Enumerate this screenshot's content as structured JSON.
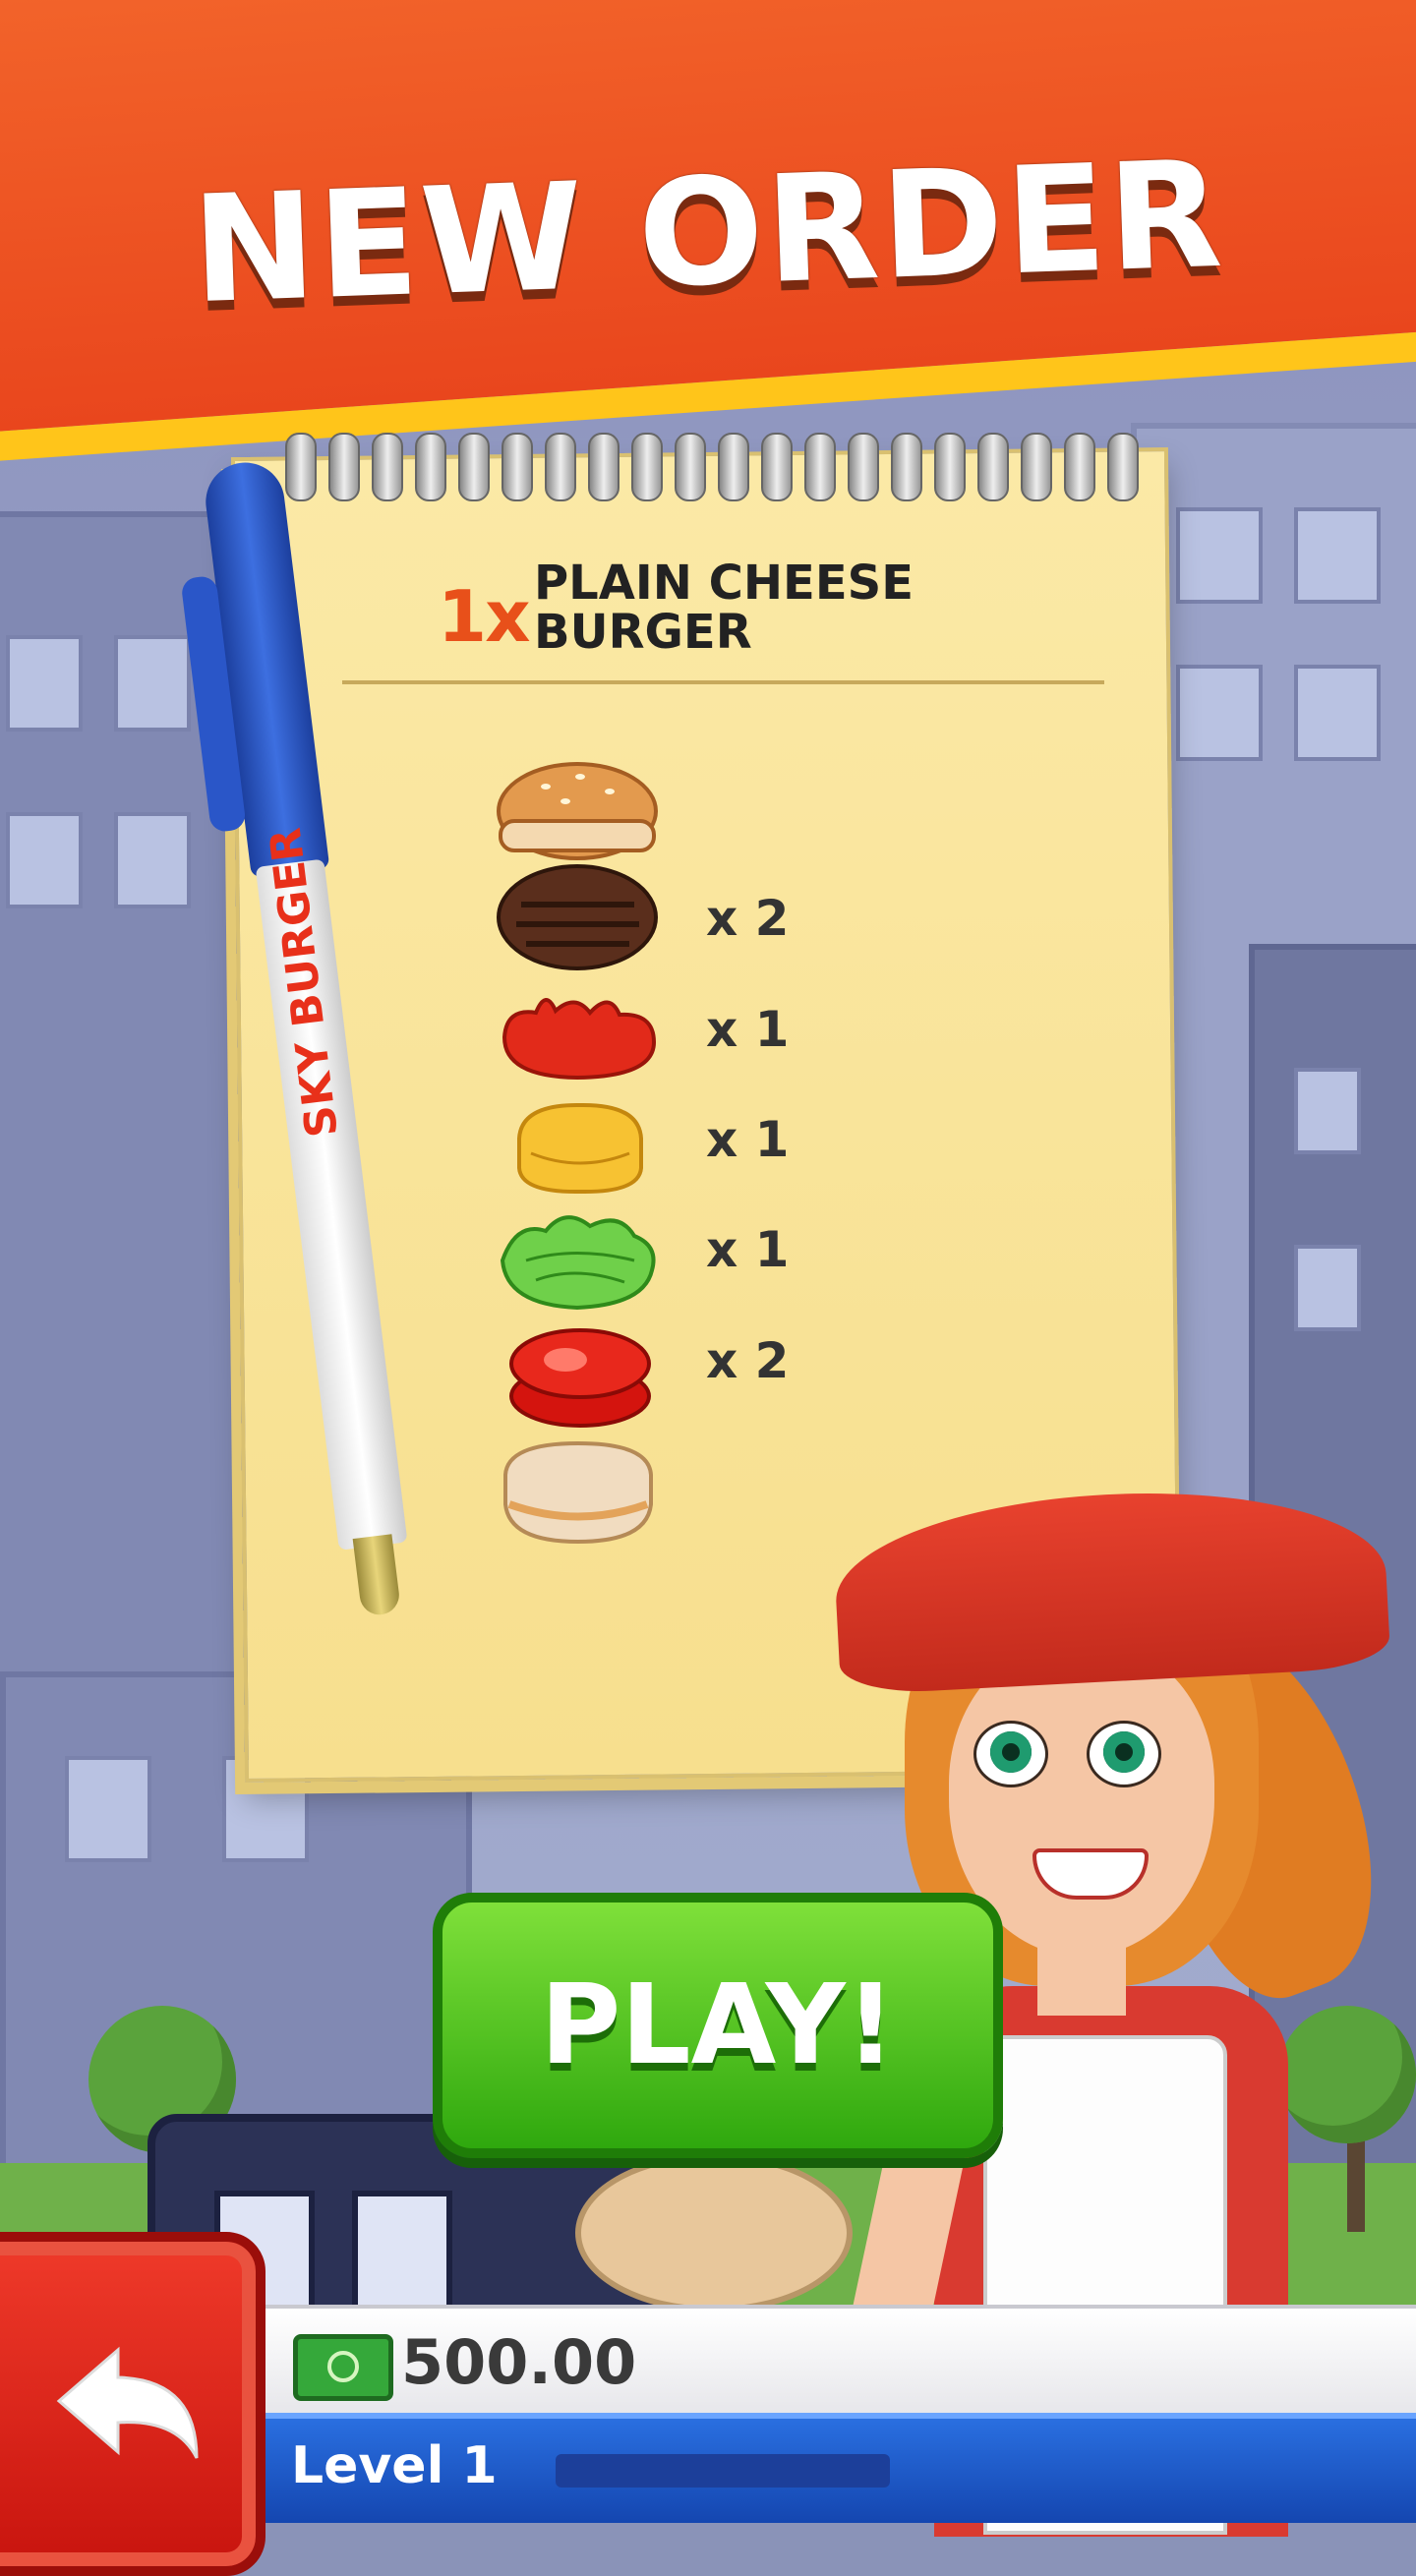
{
  "header": {
    "title": "NEW ORDER"
  },
  "order": {
    "quantity": "1x",
    "item_name": "PLAIN CHEESE BURGER"
  },
  "pen": {
    "brand": "SKY BURGER"
  },
  "ingredients": [
    {
      "name": "top bun",
      "icon": "top-bun-icon",
      "count": ""
    },
    {
      "name": "beef patty",
      "icon": "patty-icon",
      "count": "x 2"
    },
    {
      "name": "ketchup",
      "icon": "ketchup-icon",
      "count": "x 1"
    },
    {
      "name": "cheese",
      "icon": "cheese-icon",
      "count": "x 1"
    },
    {
      "name": "lettuce",
      "icon": "lettuce-icon",
      "count": "x 1"
    },
    {
      "name": "tomato",
      "icon": "tomato-icon",
      "count": "x 2"
    },
    {
      "name": "bottom bun",
      "icon": "bottom-bun-icon",
      "count": ""
    }
  ],
  "play_button": {
    "label": "PLAY!"
  },
  "status": {
    "money": "500.00",
    "level": "Level 1",
    "level_progress": 0.0
  },
  "colors": {
    "banner": "#e9461d",
    "banner_stripe": "#ffc51a",
    "play_button": "#2fa80e",
    "back_button": "#c8140e",
    "level_bar": "#1446b0"
  }
}
